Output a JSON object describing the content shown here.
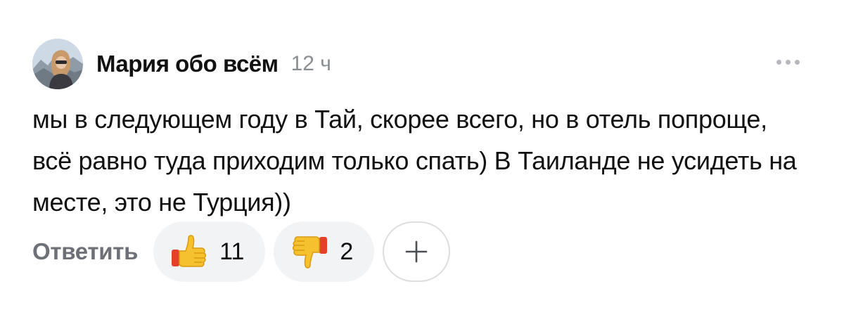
{
  "comment": {
    "author": "Мария обо всём",
    "time": "12 ч",
    "text": "мы в следующем году в Тай, скорее всего, но в отель попроще, всё равно туда приходим только спать) В Таиланде не усидеть на месте, это не Турция))"
  },
  "actions": {
    "reply_label": "Ответить",
    "like_count": "11",
    "dislike_count": "2"
  },
  "icons": {
    "more": "more-dots-icon",
    "like": "thumbs-up-icon",
    "dislike": "thumbs-down-icon",
    "add_reaction": "plus-icon"
  },
  "colors": {
    "text": "#111111",
    "muted": "#8a8d93",
    "reply": "#6d7076",
    "reaction_bg": "#f2f3f5",
    "emoji_yellow": "#f6c12f",
    "emoji_red": "#e5402a"
  }
}
